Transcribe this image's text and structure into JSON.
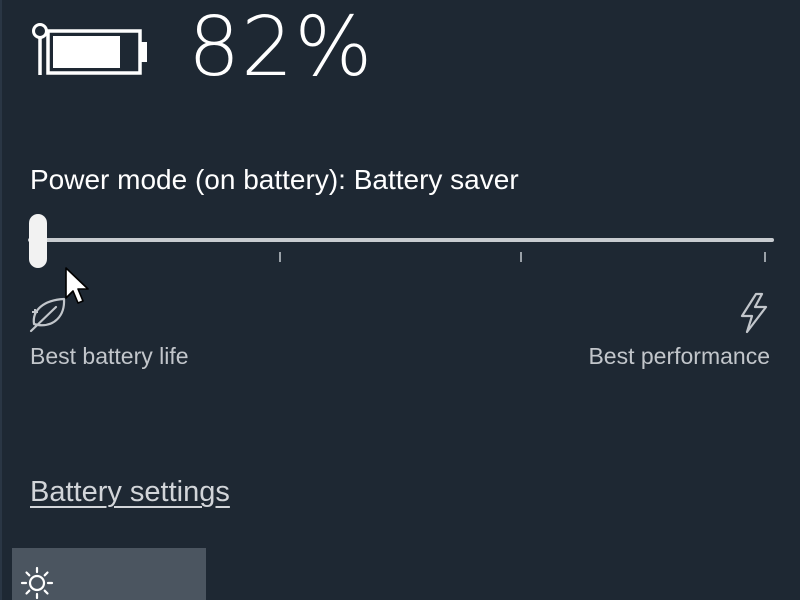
{
  "battery": {
    "percent_text": "82%",
    "charge_level": 0.82
  },
  "power_mode": {
    "label": "Power mode (on battery): Battery saver",
    "slider_position": 0,
    "slider_stops": 4,
    "left_label": "Best battery life",
    "right_label": "Best performance"
  },
  "links": {
    "battery_settings": "Battery settings"
  },
  "quick_actions": {
    "brightness_icon": "sun-icon"
  },
  "icons": {
    "battery": "battery-charging-icon",
    "left": "leaf-icon",
    "right": "lightning-bolt-icon"
  },
  "colors": {
    "background": "#1e2833",
    "text": "#ffffff",
    "secondary_text": "#c2c6cb",
    "track": "#c8ccd0",
    "tile": "#4b5560"
  }
}
